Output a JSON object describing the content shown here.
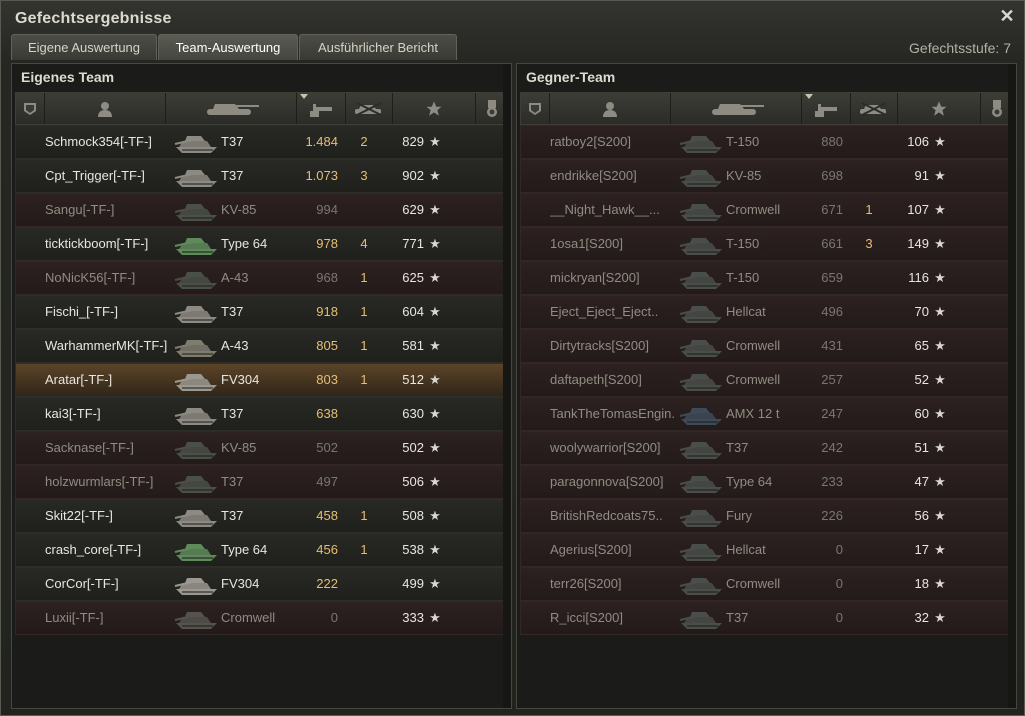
{
  "window": {
    "title": "Gefechtsergebnisse"
  },
  "tabs": [
    {
      "label": "Eigene Auswertung"
    },
    {
      "label": "Team-Auswertung"
    },
    {
      "label": "Ausführlicher Bericht"
    }
  ],
  "active_tab": 1,
  "battle_tier": "Gefechtsstufe: 7",
  "own_team": {
    "title": "Eigenes Team",
    "players": [
      {
        "name": "Schmock354[-TF-]",
        "tank": "T37",
        "damage": "1.484",
        "kills": "2",
        "xp": "829",
        "alive": true,
        "self": false,
        "tank_color": "#8c8a82"
      },
      {
        "name": "Cpt_Trigger[-TF-]",
        "tank": "T37",
        "damage": "1.073",
        "kills": "3",
        "xp": "902",
        "alive": true,
        "self": false,
        "tank_color": "#8c8a82"
      },
      {
        "name": "Sangu[-TF-]",
        "tank": "KV-85",
        "damage": "994",
        "kills": "",
        "xp": "629",
        "alive": false,
        "self": false,
        "tank_color": "#4a5048"
      },
      {
        "name": "ticktickboom[-TF-]",
        "tank": "Type 64",
        "damage": "978",
        "kills": "4",
        "xp": "771",
        "alive": true,
        "self": false,
        "tank_color": "#5f8a5a"
      },
      {
        "name": "NoNicK56[-TF-]",
        "tank": "A-43",
        "damage": "968",
        "kills": "1",
        "xp": "625",
        "alive": false,
        "self": false,
        "tank_color": "#4a5048"
      },
      {
        "name": "Fischi_[-TF-]",
        "tank": "T37",
        "damage": "918",
        "kills": "1",
        "xp": "604",
        "alive": true,
        "self": false,
        "tank_color": "#8c8a82"
      },
      {
        "name": "WarhammerMK[-TF-]",
        "tank": "A-43",
        "damage": "805",
        "kills": "1",
        "xp": "581",
        "alive": true,
        "self": false,
        "tank_color": "#7f7d70"
      },
      {
        "name": "Aratar[-TF-]",
        "tank": "FV304",
        "damage": "803",
        "kills": "1",
        "xp": "512",
        "alive": true,
        "self": true,
        "tank_color": "#9a9890"
      },
      {
        "name": "kai3[-TF-]",
        "tank": "T37",
        "damage": "638",
        "kills": "",
        "xp": "630",
        "alive": true,
        "self": false,
        "tank_color": "#8c8a82"
      },
      {
        "name": "Sacknase[-TF-]",
        "tank": "KV-85",
        "damage": "502",
        "kills": "",
        "xp": "502",
        "alive": false,
        "self": false,
        "tank_color": "#4a5048"
      },
      {
        "name": "holzwurmlars[-TF-]",
        "tank": "T37",
        "damage": "497",
        "kills": "",
        "xp": "506",
        "alive": false,
        "self": false,
        "tank_color": "#4a5048"
      },
      {
        "name": "Skit22[-TF-]",
        "tank": "T37",
        "damage": "458",
        "kills": "1",
        "xp": "508",
        "alive": true,
        "self": false,
        "tank_color": "#8c8a82"
      },
      {
        "name": "crash_core[-TF-]",
        "tank": "Type 64",
        "damage": "456",
        "kills": "1",
        "xp": "538",
        "alive": true,
        "self": false,
        "tank_color": "#5f8a5a"
      },
      {
        "name": "CorCor[-TF-]",
        "tank": "FV304",
        "damage": "222",
        "kills": "",
        "xp": "499",
        "alive": true,
        "self": false,
        "tank_color": "#9a9890"
      },
      {
        "name": "Luxii[-TF-]",
        "tank": "Cromwell",
        "damage": "0",
        "kills": "",
        "xp": "333",
        "alive": false,
        "self": false,
        "tank_color": "#55534d"
      }
    ]
  },
  "enemy_team": {
    "title": "Gegner-Team",
    "players": [
      {
        "name": "ratboy2[S200]",
        "tank": "T-150",
        "damage": "880",
        "kills": "",
        "xp": "106",
        "alive": false,
        "tank_color": "#4a4e4a"
      },
      {
        "name": "endrikke[S200]",
        "tank": "KV-85",
        "damage": "698",
        "kills": "",
        "xp": "91",
        "alive": false,
        "tank_color": "#4a4e4a"
      },
      {
        "name": "__Night_Hawk__...",
        "tank": "Cromwell",
        "damage": "671",
        "kills": "1",
        "xp": "107",
        "alive": false,
        "tank_color": "#4a4e4a"
      },
      {
        "name": "1osa1[S200]",
        "tank": "T-150",
        "damage": "661",
        "kills": "3",
        "xp": "149",
        "alive": false,
        "tank_color": "#4a4e4a"
      },
      {
        "name": "mickryan[S200]",
        "tank": "T-150",
        "damage": "659",
        "kills": "",
        "xp": "116",
        "alive": false,
        "tank_color": "#4a4e4a"
      },
      {
        "name": "Eject_Eject_Eject..",
        "tank": "Hellcat",
        "damage": "496",
        "kills": "",
        "xp": "70",
        "alive": false,
        "tank_color": "#4a4e4a"
      },
      {
        "name": "Dirtytracks[S200]",
        "tank": "Cromwell",
        "damage": "431",
        "kills": "",
        "xp": "65",
        "alive": false,
        "tank_color": "#4a4e4a"
      },
      {
        "name": "daftapeth[S200]",
        "tank": "Cromwell",
        "damage": "257",
        "kills": "",
        "xp": "52",
        "alive": false,
        "tank_color": "#4a4e4a"
      },
      {
        "name": "TankTheTomasEngin..",
        "tank": "AMX 12 t",
        "damage": "247",
        "kills": "",
        "xp": "60",
        "alive": false,
        "tank_color": "#3e4a58"
      },
      {
        "name": "woolywarrior[S200]",
        "tank": "T37",
        "damage": "242",
        "kills": "",
        "xp": "51",
        "alive": false,
        "tank_color": "#4a4e4a"
      },
      {
        "name": "paragonnova[S200]",
        "tank": "Type 64",
        "damage": "233",
        "kills": "",
        "xp": "47",
        "alive": false,
        "tank_color": "#4a4e4a"
      },
      {
        "name": "BritishRedcoats75..",
        "tank": "Fury",
        "damage": "226",
        "kills": "",
        "xp": "56",
        "alive": false,
        "tank_color": "#4a4e4a"
      },
      {
        "name": "Agerius[S200]",
        "tank": "Hellcat",
        "damage": "0",
        "kills": "",
        "xp": "17",
        "alive": false,
        "tank_color": "#4a4e4a"
      },
      {
        "name": "terr26[S200]",
        "tank": "Cromwell",
        "damage": "0",
        "kills": "",
        "xp": "18",
        "alive": false,
        "tank_color": "#4a4e4a"
      },
      {
        "name": "R_icci[S200]",
        "tank": "T37",
        "damage": "0",
        "kills": "",
        "xp": "32",
        "alive": false,
        "tank_color": "#4a4e4a"
      }
    ]
  },
  "columns": [
    {
      "icon": "squad-icon"
    },
    {
      "icon": "player-icon"
    },
    {
      "icon": "tank-icon"
    },
    {
      "icon": "damage-icon",
      "sorted": true
    },
    {
      "icon": "kills-icon"
    },
    {
      "icon": "xp-star-icon"
    },
    {
      "icon": "medal-icon"
    }
  ],
  "star_glyph": "★"
}
